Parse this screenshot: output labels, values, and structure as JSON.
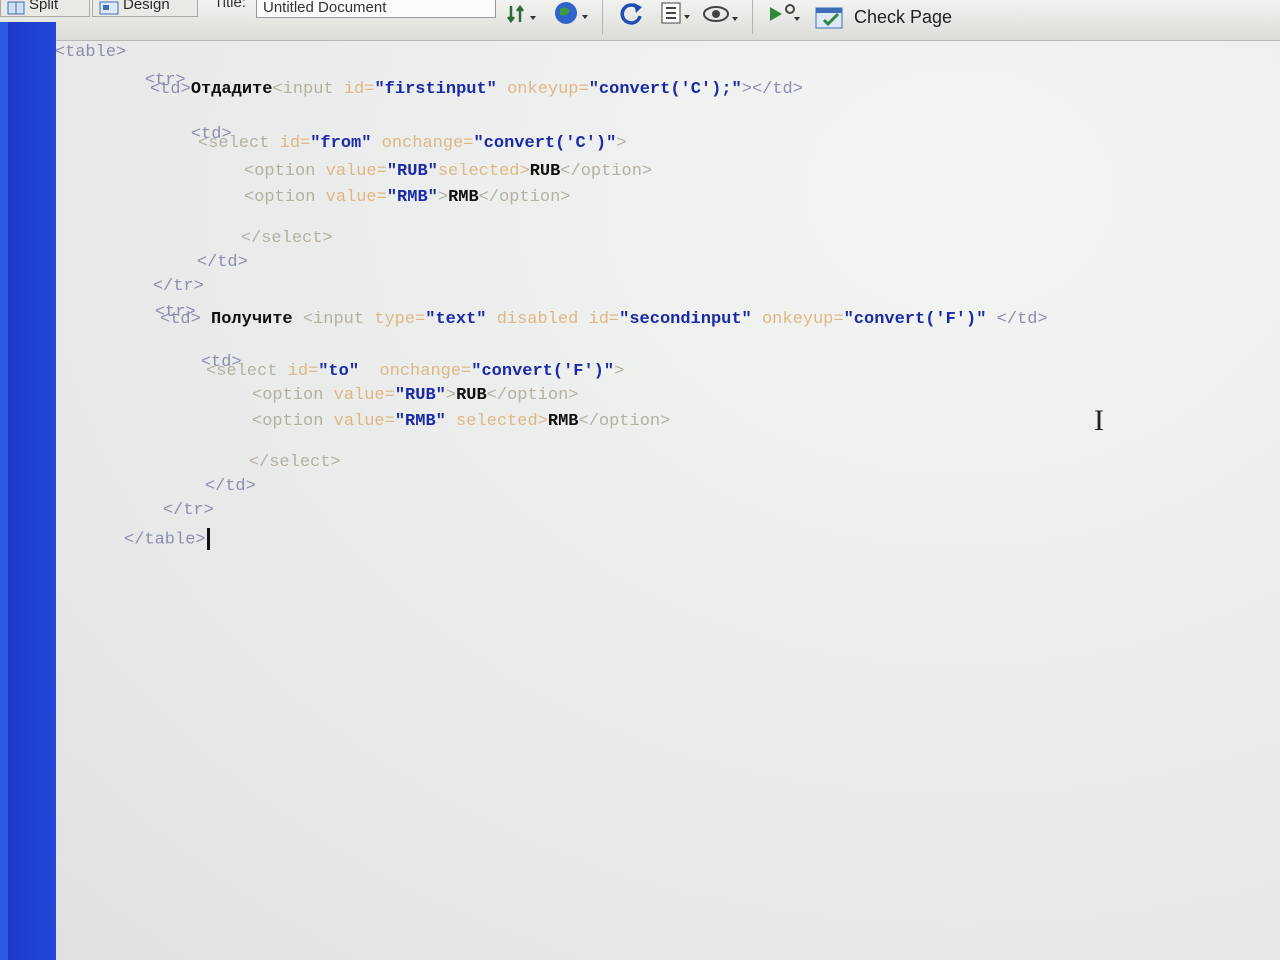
{
  "toolbar": {
    "split_label": "Split",
    "design_label": "Design",
    "title_label": "Title:",
    "title_value": "Untitled Document",
    "check_page_label": "Check Page"
  },
  "code": {
    "l1_tag": "<table>",
    "l2_tag": "<tr>",
    "l3_td": "<td>",
    "l3_text": "Отдадите",
    "l3_input": "<input",
    "l3_id_attr": " id=",
    "l3_id_val": "\"firstinput\"",
    "l3_on_attr": " onkeyup=",
    "l3_on_val": "\"convert('C');\"",
    "l3_close": "></td>",
    "l4_td": "<td>",
    "l5_select": "<select",
    "l5_id_attr": " id=",
    "l5_id_val": "\"from\"",
    "l5_on_attr": " onchange=",
    "l5_on_val": "\"convert('C')\"",
    "l5_close": ">",
    "l6_option": "<option",
    "l6_value_attr": " value=",
    "l6_value_val": "\"RUB\"",
    "l6_selected": "selected>",
    "l6_text": "RUB",
    "l6_close": "</option>",
    "l7_option": "<option",
    "l7_value_attr": " value=",
    "l7_value_val": "\"RMB\"",
    "l7_gt": ">",
    "l7_text": "RMB",
    "l7_close": "</option>",
    "l8_tag": "</select>",
    "l9_tag": "</td>",
    "l10_tag": "</tr>",
    "l11_tag": "<tr>",
    "l12_td": "<td>",
    "l12_text": " Получите ",
    "l12_input": "<input",
    "l12_type_attr": " type=",
    "l12_type_val": "\"text\"",
    "l12_disabled": " disabled",
    "l12_id_attr": " id=",
    "l12_id_val": "\"secondinput\"",
    "l12_on_attr": " onkeyup=",
    "l12_on_val": "\"convert('F')\"",
    "l12_close": " </td>",
    "l13_td": "<td>",
    "l14_select": "<select",
    "l14_id_attr": " id=",
    "l14_id_val": "\"to\"",
    "l14_on_attr": "  onchange=",
    "l14_on_val": "\"convert('F')\"",
    "l14_close": ">",
    "l15_option": "<option",
    "l15_value_attr": " value=",
    "l15_value_val": "\"RUB\"",
    "l15_gt": ">",
    "l15_text": "RUB",
    "l15_close": "</option>",
    "l16_option": "<option",
    "l16_value_attr": " value=",
    "l16_value_val": "\"RMB\"",
    "l16_selected": " selected>",
    "l16_text": "RMB",
    "l16_close": "</option>",
    "l17_tag": "</select>",
    "l18_tag": "</td>",
    "l19_tag": "</tr>",
    "l20_tag": "</table>"
  },
  "icons": [
    "split-view-icon",
    "design-view-icon",
    "file-management-icon",
    "preview-globe-icon",
    "refresh-icon",
    "view-options-icon",
    "visual-aids-icon",
    "validate-icon",
    "check-page-icon"
  ]
}
